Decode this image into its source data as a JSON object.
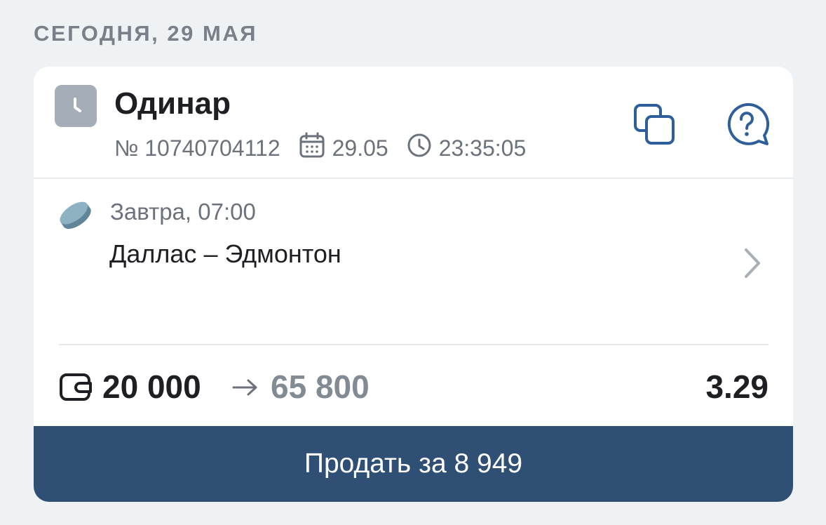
{
  "section": {
    "date_heading": "СЕГОДНЯ, 29 МАЯ"
  },
  "bet": {
    "status_icon": "clock-icon",
    "type": "Одинар",
    "number": "№ 10740704112",
    "date": "29.05",
    "time": "23:35:05",
    "actions": {
      "copy_icon": "copy-icon",
      "help_icon": "help-chat-icon"
    }
  },
  "event": {
    "sport_icon": "hockey-puck-icon",
    "start": "Завтра, 07:00",
    "teams": "Даллас – Эдмонтон"
  },
  "amounts": {
    "stake": "20 000",
    "arrow": "→",
    "payout": "65 800",
    "odds": "3.29"
  },
  "sell_button": {
    "label": "Продать за 8 949"
  },
  "colors": {
    "background": "#eff2f5",
    "card": "#ffffff",
    "accent": "#2f4f75",
    "icon_blue": "#2e5f9a",
    "muted_text": "#6c727b"
  }
}
